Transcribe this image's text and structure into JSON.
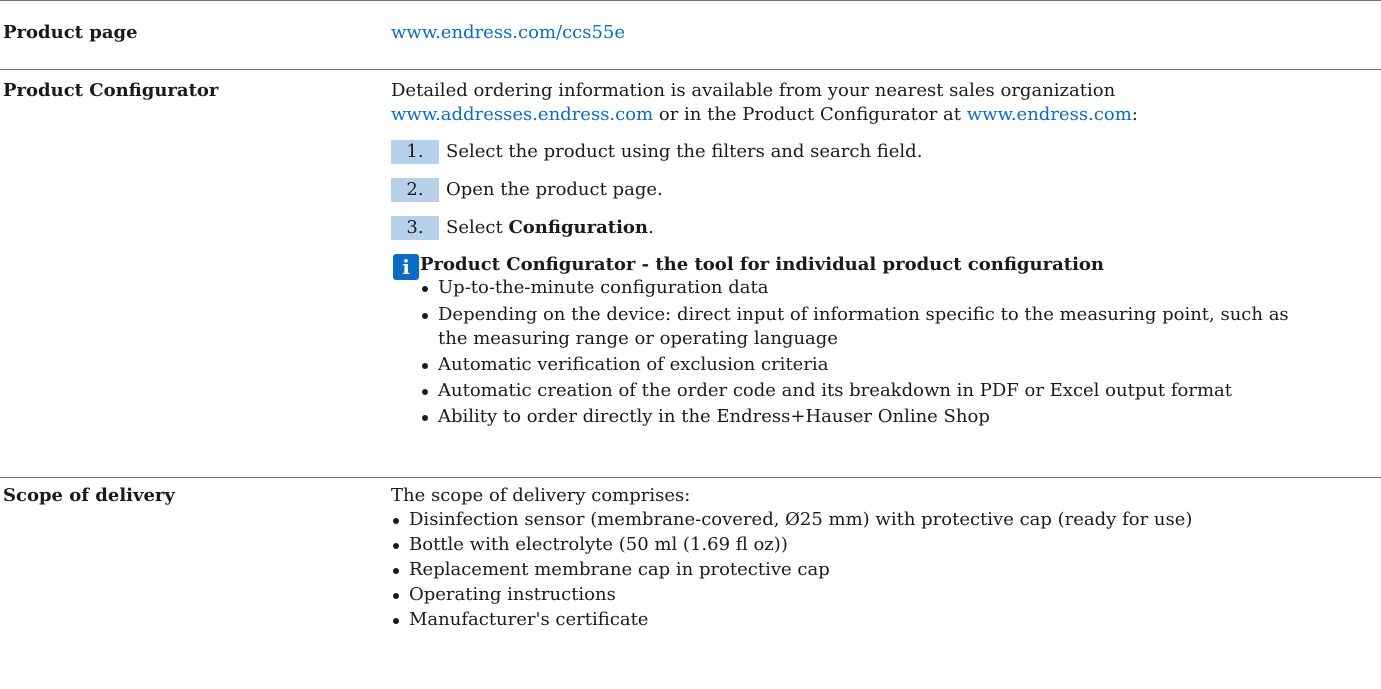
{
  "sections": {
    "product_page": {
      "label": "Product page",
      "link": "www.endress.com/ccs55e"
    },
    "product_configurator": {
      "label": "Product Configurator",
      "intro_line1": "Detailed ordering information is available from your nearest sales organization",
      "intro_link1": "www.addresses.endress.com",
      "intro_mid": " or in the Product Configurator at ",
      "intro_link2": "www.endress.com",
      "intro_end": ":",
      "steps": [
        {
          "num": "1.",
          "text": "Select the product using the filters and search field."
        },
        {
          "num": "2.",
          "text": "Open the product page."
        },
        {
          "num": "3.",
          "text_pre": "Select ",
          "text_bold": "Configuration",
          "text_post": "."
        }
      ],
      "note": {
        "icon": "info-icon",
        "title": "Product Configurator - the tool for individual product configuration",
        "items": [
          "Up-to-the-minute configuration data",
          "Depending on the device: direct input of information specific to the measuring point, such as",
          "the measuring range or operating language",
          "Automatic verification of exclusion criteria",
          "Automatic creation of the order code and its breakdown in PDF or Excel output format",
          "Ability to order directly in the Endress+Hauser Online Shop"
        ]
      }
    },
    "scope_of_delivery": {
      "label": "Scope of delivery",
      "intro": "The scope of delivery comprises:",
      "items": [
        "Disinfection sensor (membrane-covered, Ø25 mm) with protective cap (ready for use)",
        "Bottle with electrolyte (50 ml (1.69 fl oz))",
        "Replacement membrane cap in protective cap",
        "Operating instructions",
        "Manufacturer's certificate"
      ]
    }
  },
  "colors": {
    "link": "#0a6cc4",
    "step_badge": "#b6d1e9",
    "rule": "#6e6e6e"
  }
}
